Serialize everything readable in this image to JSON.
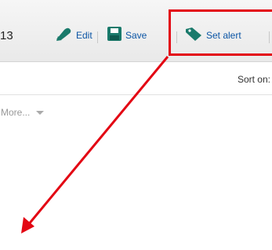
{
  "toolbar": {
    "count": "13",
    "edit_label": "Edit",
    "save_label": "Save",
    "alert_label": "Set alert"
  },
  "sortbar": {
    "label": "Sort on:"
  },
  "results": {
    "more_label": "More..."
  },
  "colors": {
    "link": "#0b55a5",
    "icon_green": "#1a7a6b",
    "annotation_red": "#e30613"
  },
  "icons": [
    "pencil-icon",
    "save-icon",
    "alert-tag-icon",
    "chevron-down-icon",
    "arrow-annotation"
  ]
}
